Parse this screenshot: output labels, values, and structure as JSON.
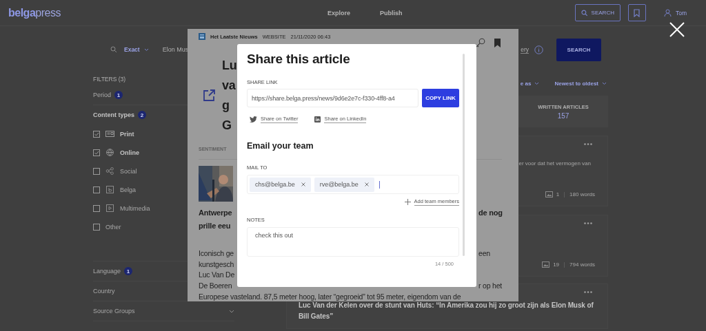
{
  "header": {
    "logo": "**belga**press",
    "nav": [
      "Explore",
      "Publish"
    ],
    "search_button": "SEARCH",
    "user": "Tom"
  },
  "search_bar": {
    "mode": "Exact",
    "query": "Elon Mus",
    "help_link": "ery",
    "search_button": "SEARCH"
  },
  "filters": {
    "title": "FILTERS (3)",
    "groups": [
      {
        "label": "Period",
        "count": "1",
        "expanded": false,
        "chevron": false
      },
      {
        "label": "Content types",
        "count": "2",
        "expanded": true,
        "chevron": false,
        "options": [
          {
            "label": "Print",
            "checked": true
          },
          {
            "label": "Online",
            "checked": true
          },
          {
            "label": "Social",
            "checked": false
          },
          {
            "label": "Belga",
            "checked": false
          },
          {
            "label": "Multimedia",
            "checked": false
          },
          {
            "label": "Other",
            "checked": false
          }
        ]
      },
      {
        "label": "Language",
        "count": "1",
        "expanded": false,
        "chevron": false
      },
      {
        "label": "Country",
        "expanded": false,
        "chevron": false
      },
      {
        "label": "Source Groups",
        "expanded": false,
        "chevron": true
      }
    ]
  },
  "results": {
    "save_as": "e as",
    "sort_order": "Newest to oldest",
    "stats": [
      {
        "label": "WRITTEN ARTICLES",
        "value": "157"
      }
    ],
    "cards": [
      {
        "snippet": "er voor dat het vermogen van",
        "image_count": "1",
        "word_count": "180 words"
      },
      {
        "image_count": "19",
        "word_count": "794 words"
      },
      {
        "title": "Luc Van der Kelen over de stunt van Huts: “In Amerika zou hij zo groot zijn als Elon Musk of Bill Gates”"
      }
    ]
  },
  "article": {
    "source": "Het Laatste Nieuws",
    "medium": "WEBSITE",
    "date": "21/11/2020 06:43",
    "title_lines": [
      "Lu",
      "va",
      "g",
      "G"
    ],
    "sentiment_label": "SENTIMENT",
    "lead_lines": [
      {
        "left": "Antwerpe",
        "right": "de nog"
      },
      {
        "left": "prille eeu"
      }
    ],
    "body_lines": [
      {
        "left": "Iconisch ge",
        "right": "een"
      },
      {
        "left": "kunstgesch"
      },
      {
        "left": "Luc Van De"
      },
      {
        "left": "De Boeren",
        "right": "r op het"
      }
    ],
    "body_full_line": "Europese vasteland. 87,5 meter hoog, later “gegroeid” tot 95 meter, eigendom van de"
  },
  "share_modal": {
    "title": "Share this article",
    "link_label": "SHARE LINK",
    "link": "https://share.belga.press/news/9d6e2e7c-f330-4ff8-a4",
    "copy_button": "COPY LINK",
    "share_links": [
      "Share on Twitter",
      "Share on LinkedIn"
    ],
    "email_title": "Email your team",
    "mail_to_label": "MAIL TO",
    "recipients": [
      "chs@belga.be",
      "rve@belga.be"
    ],
    "add_members": "Add team members",
    "notes_label": "NOTES",
    "notes": "check this out",
    "char_count": "14 / 500"
  }
}
